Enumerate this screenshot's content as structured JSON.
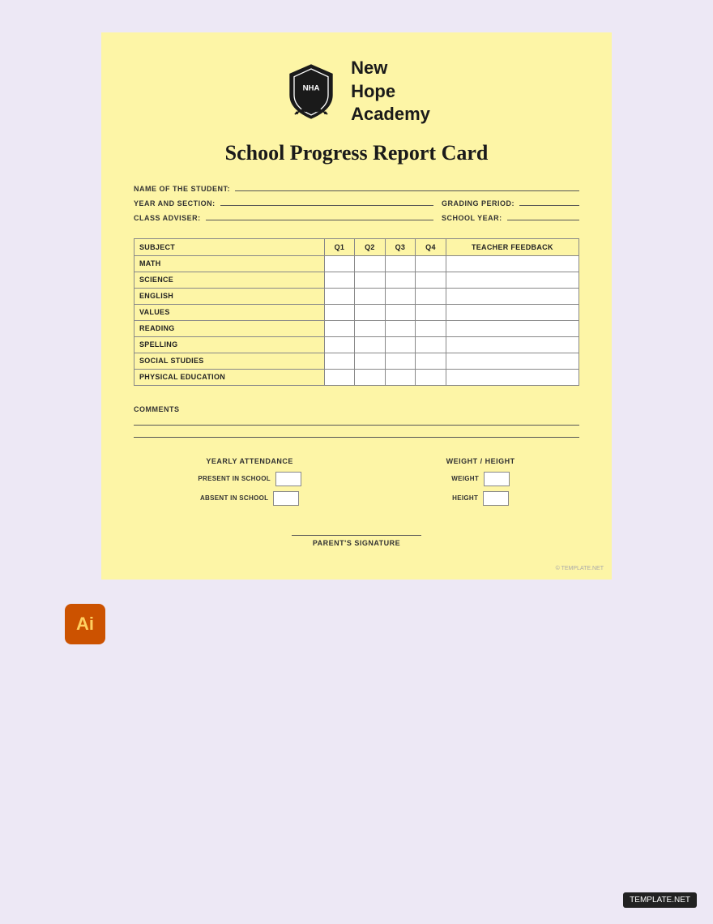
{
  "school": {
    "name": "New\nHope\nAcademy",
    "name_line1": "New",
    "name_line2": "Hope",
    "name_line3": "Academy",
    "logo_letters": "NHA"
  },
  "report": {
    "title": "School Progress Report Card"
  },
  "fields": {
    "name_label": "NAME OF THE STUDENT:",
    "year_label": "YEAR AND SECTION:",
    "grading_label": "GRADING PERIOD:",
    "adviser_label": "CLASS ADVISER:",
    "school_year_label": "SCHOOL YEAR:"
  },
  "table": {
    "headers": {
      "subject": "SUBJECT",
      "q1": "Q1",
      "q2": "Q2",
      "q3": "Q3",
      "q4": "Q4",
      "feedback": "TEACHER FEEDBACK"
    },
    "subjects": [
      "MATH",
      "SCIENCE",
      "ENGLISH",
      "VALUES",
      "READING",
      "SPELLING",
      "SOCIAL STUDIES",
      "PHYSICAL EDUCATION"
    ]
  },
  "comments": {
    "label": "COMMENTS"
  },
  "attendance": {
    "title": "YEARLY ATTENDANCE",
    "present_label": "PRESENT IN SCHOOL",
    "absent_label": "ABSENT IN SCHOOL"
  },
  "weight_height": {
    "title": "WEIGHT / HEIGHT",
    "weight_label": "WEIGHT",
    "height_label": "HEIGHT"
  },
  "signature": {
    "label": "PARENT'S SIGNATURE"
  },
  "watermark": "© TEMPLATE.NET",
  "app_icon": "Ai",
  "template_badge": "TEMPLATE.NET"
}
